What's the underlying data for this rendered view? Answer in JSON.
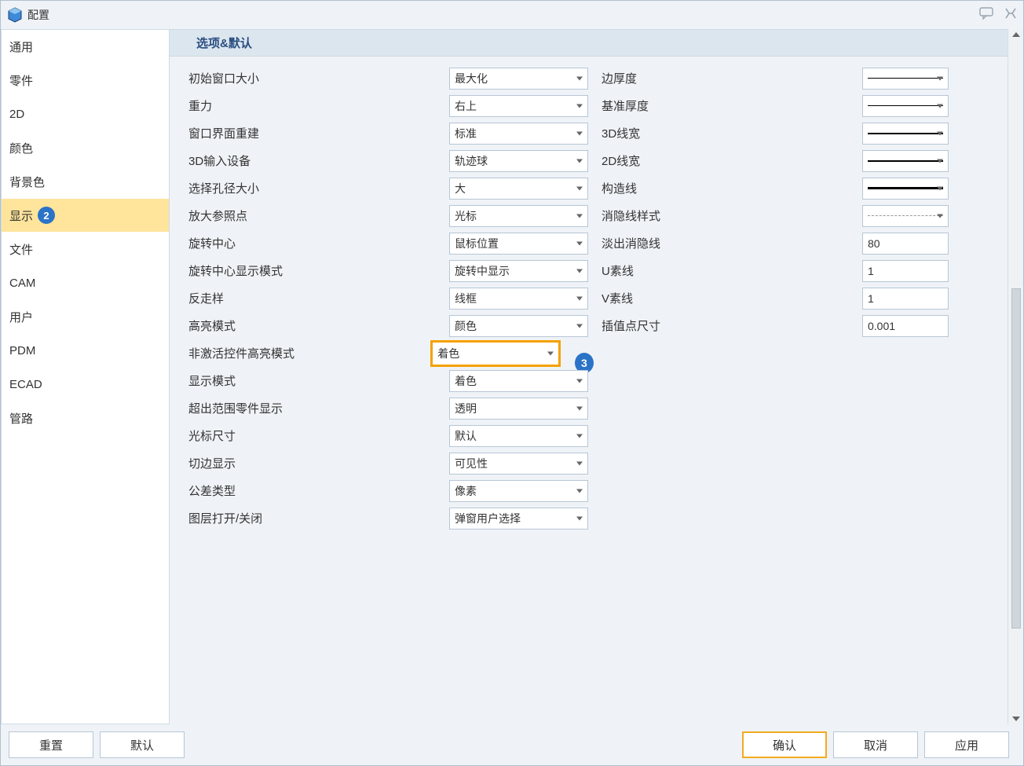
{
  "title": "配置",
  "sidebar": {
    "items": [
      {
        "id": "general",
        "label": "通用"
      },
      {
        "id": "part",
        "label": "零件"
      },
      {
        "id": "2d",
        "label": "2D"
      },
      {
        "id": "color",
        "label": "颜色"
      },
      {
        "id": "bgcolor",
        "label": "背景色"
      },
      {
        "id": "display",
        "label": "显示"
      },
      {
        "id": "file",
        "label": "文件"
      },
      {
        "id": "cam",
        "label": "CAM"
      },
      {
        "id": "user",
        "label": "用户"
      },
      {
        "id": "pdm",
        "label": "PDM"
      },
      {
        "id": "ecad",
        "label": "ECAD"
      },
      {
        "id": "pipe",
        "label": "管路"
      }
    ],
    "selected": "display",
    "selected_badge": "2"
  },
  "section": {
    "header": "选项&默认"
  },
  "left": {
    "initial_window_size": {
      "label": "初始窗口大小",
      "value": "最大化"
    },
    "gravity": {
      "label": "重力",
      "value": "右上"
    },
    "window_rebuild": {
      "label": "窗口界面重建",
      "value": "标准"
    },
    "input_3d": {
      "label": "3D输入设备",
      "value": "轨迹球"
    },
    "aperture_size": {
      "label": "选择孔径大小",
      "value": "大"
    },
    "zoom_ref": {
      "label": "放大参照点",
      "value": "光标"
    },
    "rotate_center": {
      "label": "旋转中心",
      "value": "鼠标位置"
    },
    "rotate_center_mode": {
      "label": "旋转中心显示模式",
      "value": "旋转中显示"
    },
    "antialias": {
      "label": "反走样",
      "value": "线框"
    },
    "highlight_mode": {
      "label": "高亮模式",
      "value": "颜色"
    },
    "inactive_highlight": {
      "label": "非激活控件高亮模式",
      "value": "着色"
    },
    "display_mode": {
      "label": "显示模式",
      "value": "着色"
    },
    "out_of_range": {
      "label": "超出范围零件显示",
      "value": "透明"
    },
    "cursor_size": {
      "label": "光标尺寸",
      "value": "默认"
    },
    "tangent_edge": {
      "label": "切边显示",
      "value": "可见性"
    },
    "tolerance_type": {
      "label": "公差类型",
      "value": "像素"
    },
    "layer_toggle": {
      "label": "图层打开/关闭",
      "value": "弹窗用户选择"
    }
  },
  "right": {
    "edge_thickness": {
      "label": "边厚度"
    },
    "datum_thickness": {
      "label": "基准厚度"
    },
    "line3d": {
      "label": "3D线宽"
    },
    "line2d": {
      "label": "2D线宽"
    },
    "construct_line": {
      "label": "构造线"
    },
    "hidden_style": {
      "label": "消隐线样式"
    },
    "fade_hidden": {
      "label": "淡出消隐线",
      "value": "80"
    },
    "u_lines": {
      "label": "U素线",
      "value": "1"
    },
    "v_lines": {
      "label": "V素线",
      "value": "1"
    },
    "interp_size": {
      "label": "插值点尺寸",
      "value": "0.001"
    }
  },
  "callouts": {
    "inactive_highlight": "3"
  },
  "footer": {
    "reset": "重置",
    "default": "默认",
    "ok": "确认",
    "cancel": "取消",
    "apply": "应用"
  }
}
